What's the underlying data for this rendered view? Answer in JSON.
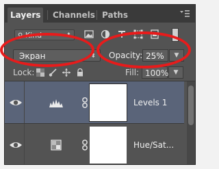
{
  "tabs": [
    {
      "label": "Layers",
      "active": true
    },
    {
      "label": "Channels",
      "active": false
    },
    {
      "label": "Paths",
      "active": false
    }
  ],
  "filter": {
    "kind_label": "Kind"
  },
  "blend_mode": {
    "value": "Экран"
  },
  "opacity": {
    "label": "Opacity:",
    "value": "25%"
  },
  "lock": {
    "label": "Lock:"
  },
  "fill": {
    "label": "Fill:",
    "value": "100%"
  },
  "layers": [
    {
      "name": "Levels 1",
      "selected": true,
      "icon": "levels-icon"
    },
    {
      "name": "Hue/Sat...",
      "selected": false,
      "icon": "hue-saturation-icon"
    }
  ],
  "colors": {
    "annotation": "#e81b1b",
    "panel": "#535353",
    "selection": "#5a6479"
  }
}
